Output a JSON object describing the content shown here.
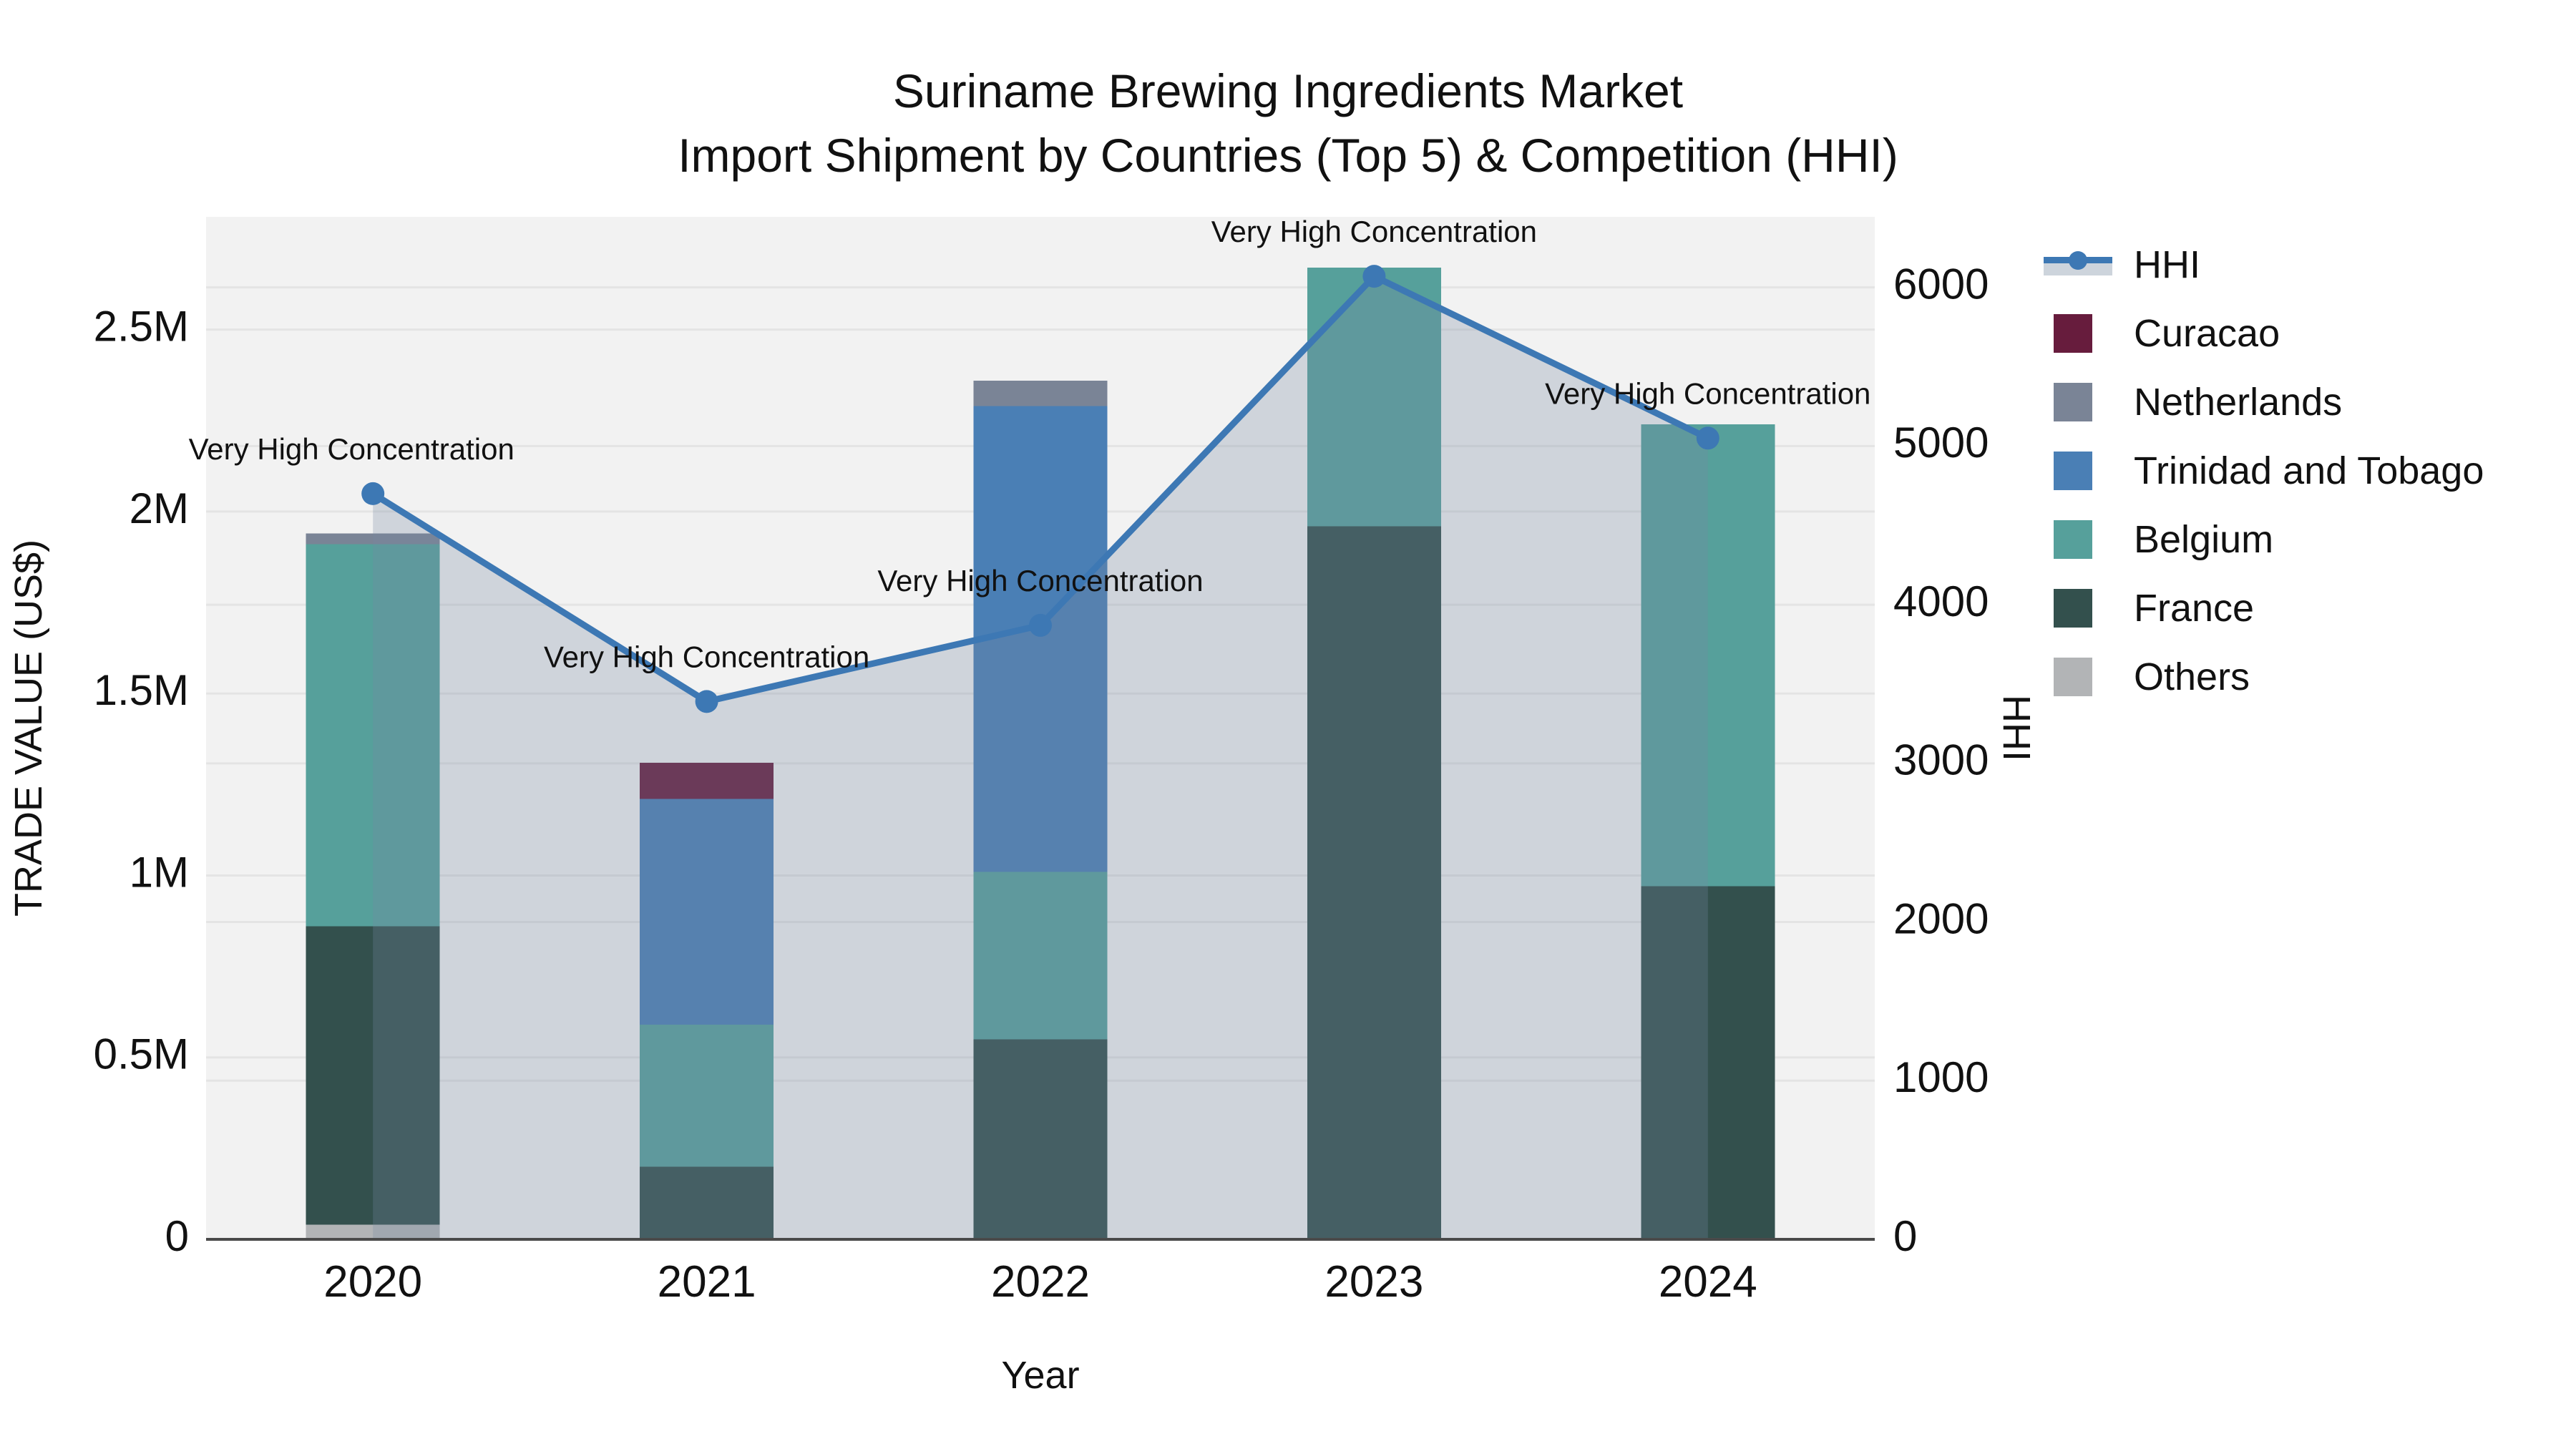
{
  "title": {
    "line1": "Suriname Brewing Ingredients Market",
    "line2": "Import Shipment by Countries (Top 5) & Competition (HHI)"
  },
  "axes": {
    "x": {
      "title": "Year",
      "categories": [
        "2020",
        "2021",
        "2022",
        "2023",
        "2024"
      ]
    },
    "y_left": {
      "title": "TRADE VALUE (US$)",
      "tick_labels": [
        "0",
        "0.5M",
        "1M",
        "1.5M",
        "2M",
        "2.5M"
      ],
      "tick_values": [
        0,
        0.5,
        1,
        1.5,
        2,
        2.5
      ],
      "max": 2.81
    },
    "y_right": {
      "title": "HHI",
      "tick_labels": [
        "0",
        "1000",
        "2000",
        "3000",
        "4000",
        "5000",
        "6000"
      ],
      "tick_values": [
        0,
        1000,
        2000,
        3000,
        4000,
        5000,
        6000
      ],
      "max": 6445
    }
  },
  "legend": {
    "items": [
      {
        "label": "HHI",
        "type": "line"
      },
      {
        "label": "Curacao",
        "type": "box"
      },
      {
        "label": "Netherlands",
        "type": "box"
      },
      {
        "label": "Trinidad and Tobago",
        "type": "box"
      },
      {
        "label": "Belgium",
        "type": "box"
      },
      {
        "label": "France",
        "type": "box"
      },
      {
        "label": "Others",
        "type": "box"
      }
    ]
  },
  "colors": {
    "HHI": "#3d78b4",
    "Curacao": "#671c3d",
    "Netherlands": "#7a8496",
    "Trinidad and Tobago": "#4a7fb5",
    "Belgium": "#56a09b",
    "France": "#33504d",
    "Others": "#b2b4b6",
    "area_fill": "rgba(120,135,160,0.28)",
    "legend_area_band": "#cdd4dc",
    "plot_background": "#f2f2f2",
    "gridline": "#e4e4e4",
    "axis_line": "#4a4a4a",
    "text": "#111111"
  },
  "annotations": [
    "Very High Concentration",
    "Very High Concentration",
    "Very High Concentration",
    "Very High Concentration",
    "Very High Concentration"
  ],
  "chart_data": {
    "type": "bar",
    "subtype": "stacked-bars-with-hhi-line-and-area",
    "title": "Suriname Brewing Ingredients Market — Import Shipment by Countries (Top 5) & Competition (HHI)",
    "categories": [
      "2020",
      "2021",
      "2022",
      "2023",
      "2024"
    ],
    "xlabel": "Year",
    "ylabel_left": "TRADE VALUE (US$)",
    "ylabel_right": "HHI",
    "bar_unit": "million US$",
    "stack_order_bottom_to_top": [
      "Others",
      "France",
      "Belgium",
      "Trinidad and Tobago",
      "Netherlands",
      "Curacao"
    ],
    "series": [
      {
        "name": "Others",
        "values": [
          0.04,
          0,
          0,
          0,
          0
        ]
      },
      {
        "name": "France",
        "values": [
          0.82,
          0.2,
          0.55,
          1.96,
          0.97
        ]
      },
      {
        "name": "Belgium",
        "values": [
          1.05,
          0.39,
          0.46,
          0.71,
          1.27
        ]
      },
      {
        "name": "Trinidad and Tobago",
        "values": [
          0,
          0.62,
          1.28,
          0,
          0
        ]
      },
      {
        "name": "Netherlands",
        "values": [
          0.03,
          0,
          0.07,
          0,
          0
        ]
      },
      {
        "name": "Curacao",
        "values": [
          0,
          0.1,
          0,
          0,
          0
        ]
      }
    ],
    "bar_totals": [
      1.94,
      1.31,
      2.36,
      2.67,
      2.24
    ],
    "line_series": {
      "name": "HHI",
      "axis": "right",
      "values": [
        4700,
        3390,
        3870,
        6070,
        5050
      ],
      "area_fill": true
    },
    "ylim_left": [
      0,
      2810000
    ],
    "ylim_right": [
      0,
      6445
    ],
    "grid": "horizontal, both axes",
    "legend_position": "right"
  }
}
